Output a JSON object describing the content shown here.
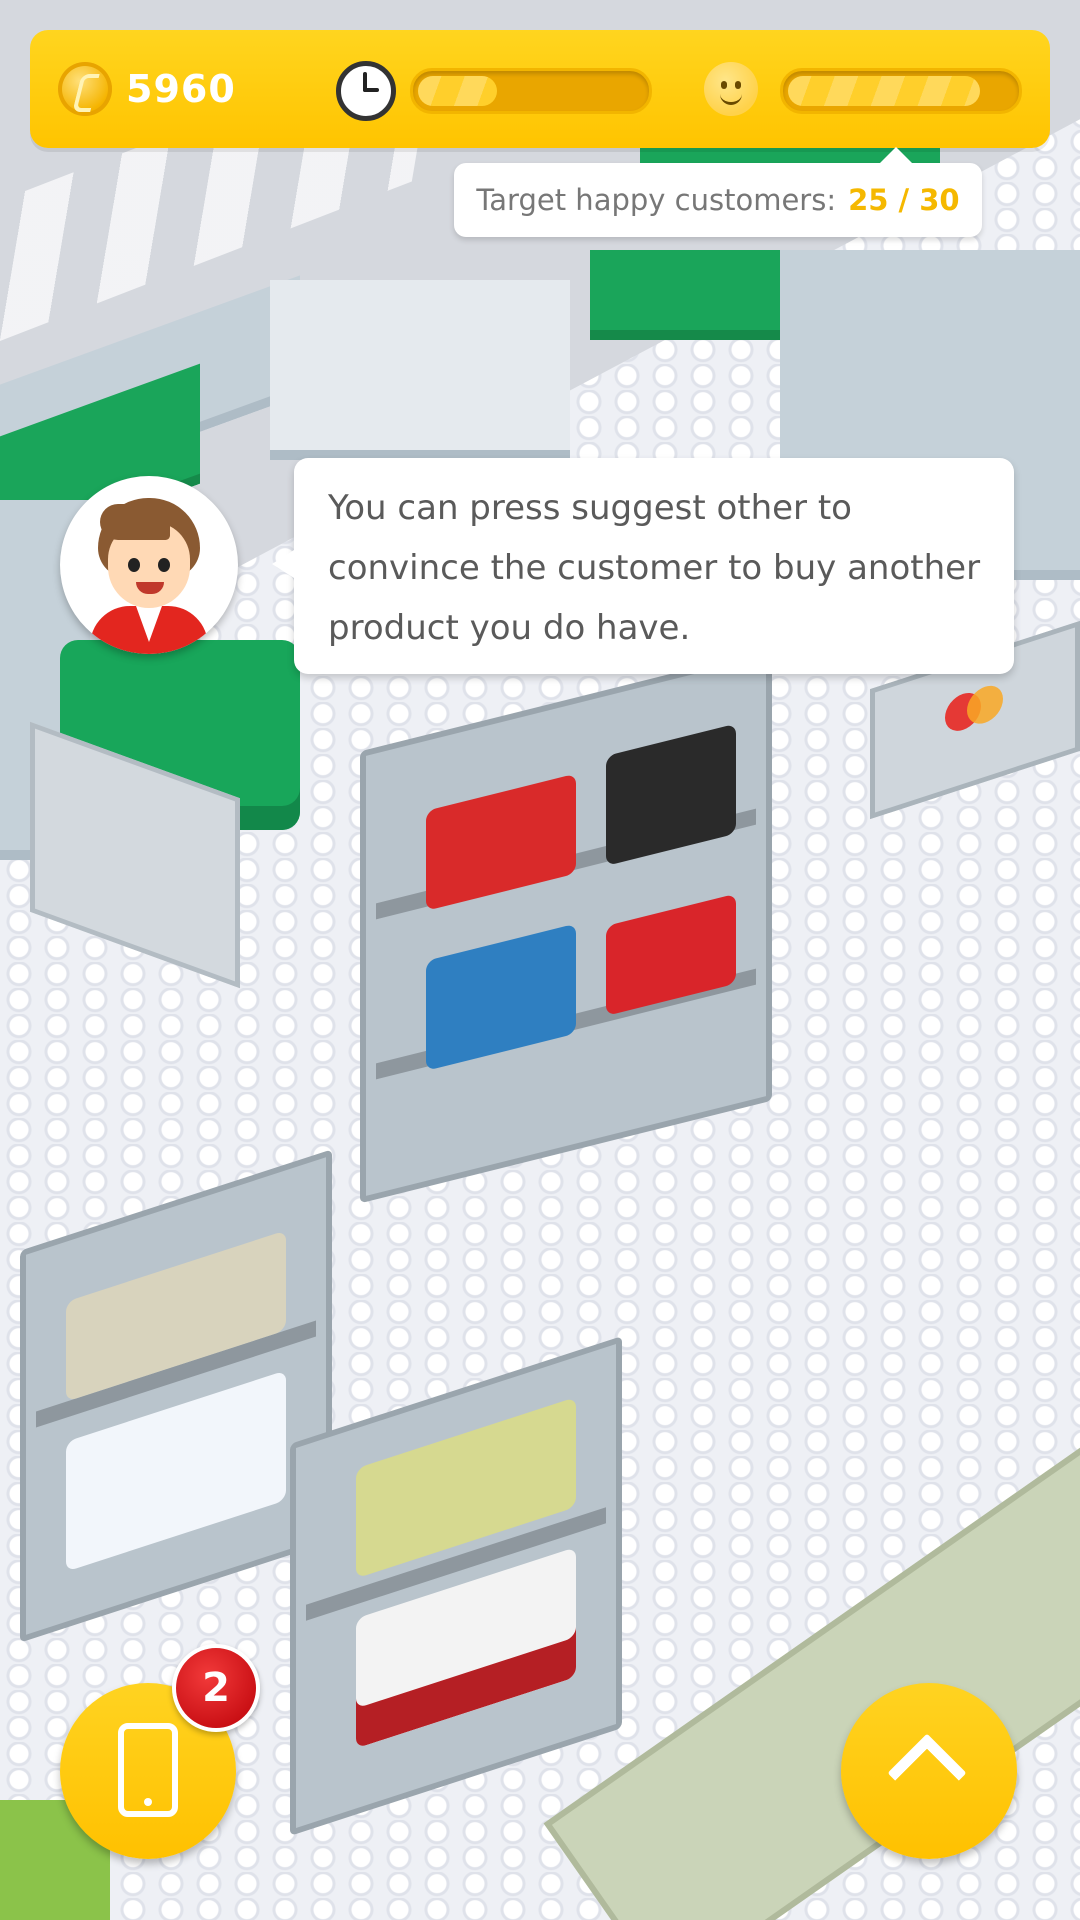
{
  "hud": {
    "coin_icon": "coin-icon",
    "coins": "5960",
    "clock_icon": "clock-icon",
    "time_progress": 0.35,
    "smile_icon": "smile-face-icon",
    "happiness_progress": 0.85,
    "target_label": "Target happy customers:",
    "target_count": "25 / 30"
  },
  "guide": {
    "avatar": "guide-avatar",
    "message": "You can press suggest other to convince the customer to buy another product you do have."
  },
  "controls": {
    "phone_icon": "phone-icon",
    "phone_badge": "2",
    "expand_icon": "chevron-up-icon"
  },
  "colors": {
    "accent": "#ffc400",
    "badge": "#d41a1a",
    "target_highlight": "#f5b800"
  }
}
